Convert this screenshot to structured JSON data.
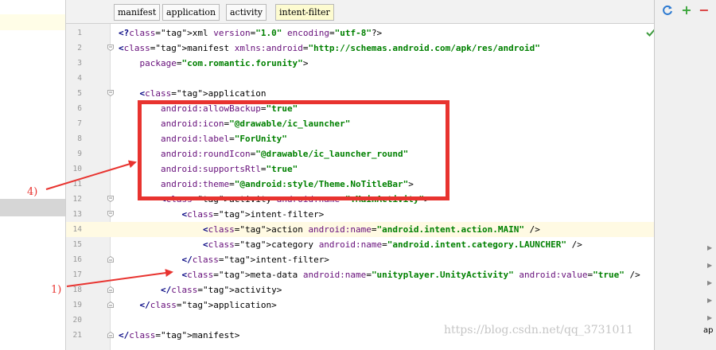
{
  "tabs": [
    "manifest",
    "application",
    "activity",
    "intent-filter"
  ],
  "active_tab": "intent-filter",
  "right_panel": {
    "refresh_icon": "refresh-icon",
    "add_label": "+",
    "remove_label": "−",
    "bottom_label": "ap"
  },
  "code_lines": [
    {
      "n": "1",
      "text": "<?xml version=\"1.0\" encoding=\"utf-8\"?>"
    },
    {
      "n": "2",
      "text": "<manifest xmlns:android=\"http://schemas.android.com/apk/res/android\""
    },
    {
      "n": "3",
      "text": "    package=\"com.romantic.forunity\">"
    },
    {
      "n": "4",
      "text": ""
    },
    {
      "n": "5",
      "text": "    <application"
    },
    {
      "n": "6",
      "text": "        android:allowBackup=\"true\""
    },
    {
      "n": "7",
      "text": "        android:icon=\"@drawable/ic_launcher\""
    },
    {
      "n": "8",
      "text": "        android:label=\"ForUnity\""
    },
    {
      "n": "9",
      "text": "        android:roundIcon=\"@drawable/ic_launcher_round\""
    },
    {
      "n": "10",
      "text": "        android:supportsRtl=\"true\""
    },
    {
      "n": "11",
      "text": "        android:theme=\"@android:style/Theme.NoTitleBar\">"
    },
    {
      "n": "12",
      "text": "        <activity android:name=\".MainActivity\">"
    },
    {
      "n": "13",
      "text": "            <intent-filter>"
    },
    {
      "n": "14",
      "text": "                <action android:name=\"android.intent.action.MAIN\" />"
    },
    {
      "n": "15",
      "text": "                <category android:name=\"android.intent.category.LAUNCHER\" />"
    },
    {
      "n": "16",
      "text": "            </intent-filter>"
    },
    {
      "n": "17",
      "text": "            <meta-data android:name=\"unityplayer.UnityActivity\" android:value=\"true\" />"
    },
    {
      "n": "18",
      "text": "        </activity>"
    },
    {
      "n": "19",
      "text": "    </application>"
    },
    {
      "n": "20",
      "text": ""
    },
    {
      "n": "21",
      "text": "</manifest>"
    }
  ],
  "current_line": "14",
  "annotations": {
    "label_4": "4)",
    "label_1": "1)",
    "color": "#e8332f"
  },
  "watermark": "https://blog.csdn.net/qq_3731011"
}
